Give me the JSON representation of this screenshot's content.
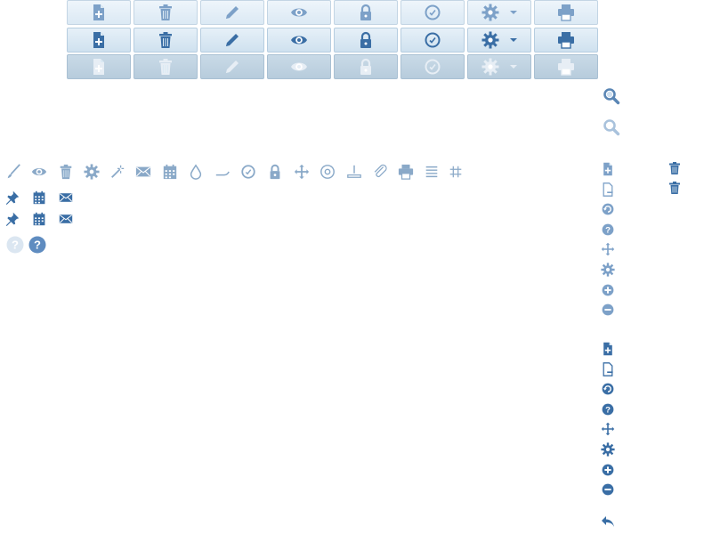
{
  "colors": {
    "icon_dark": "#3a6ea5",
    "icon_light": "#7da1c8",
    "icon_disabled": "#e7eef5",
    "icon_gray": "#8aa9c8",
    "button_top": "#eef5fb",
    "button_bottom": "#dbe9f4",
    "button_border": "#c3d5e4"
  },
  "toolbar_rows": [
    {
      "state": "normal",
      "icons": [
        "add-document",
        "trash",
        "pencil",
        "eye",
        "lock",
        "clock",
        "gear-dropdown",
        "printer"
      ]
    },
    {
      "state": "hover",
      "icons": [
        "add-document",
        "trash",
        "pencil",
        "eye",
        "lock",
        "clock",
        "gear-dropdown",
        "printer"
      ]
    },
    {
      "state": "disabled",
      "icons": [
        "add-document",
        "trash",
        "pencil",
        "eye",
        "lock",
        "clock",
        "gear-dropdown",
        "printer"
      ]
    }
  ],
  "search_icons": [
    "search-active",
    "search-inactive"
  ],
  "small_icon_strip": [
    "brush",
    "eye",
    "trash",
    "gear",
    "magic-wand",
    "mail",
    "calendar",
    "drop",
    "cursor",
    "clock",
    "lock",
    "move",
    "at-sign",
    "download",
    "paperclip",
    "printer",
    "list",
    "grid"
  ],
  "pin_rows": [
    [
      "pin",
      "calendar",
      "envelope"
    ],
    [
      "pin",
      "calendar",
      "envelope"
    ]
  ],
  "help_icons": [
    "help-light",
    "help-dark"
  ],
  "right_icon_column_a": [
    "add-file",
    "remove-file",
    "undo",
    "help",
    "move",
    "gear",
    "plus",
    "minus"
  ],
  "right_icon_column_b": [
    "add-file",
    "remove-file",
    "undo",
    "help",
    "move",
    "gear",
    "plus",
    "minus"
  ],
  "right_trash_icons": [
    "trash",
    "trash"
  ],
  "reply_icon": "reply"
}
